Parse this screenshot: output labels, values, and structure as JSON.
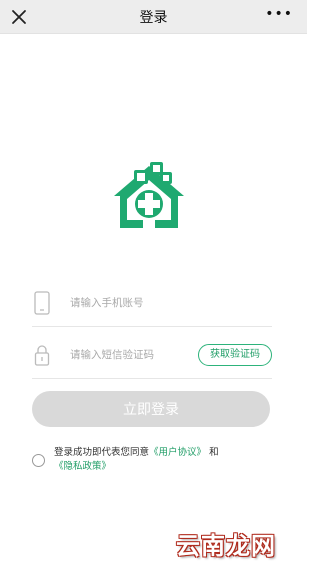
{
  "header": {
    "title": "登录",
    "close_icon": "close-icon",
    "more_label": "•••"
  },
  "logo": {
    "icon": "hospital-house-icon",
    "color": "#1fa970"
  },
  "phone": {
    "placeholder": "请输入手机账号",
    "icon": "phone-icon"
  },
  "code": {
    "placeholder": "请输入短信验证码",
    "icon": "lock-icon",
    "get_code_label": "获取验证码"
  },
  "login_button": {
    "label": "立即登录"
  },
  "agreement": {
    "prefix": "登录成功即代表您同意",
    "user_agreement": "《用户协议》",
    "and": "和",
    "privacy_policy": "《隐私政策》"
  },
  "watermark": {
    "text": "云南龙网"
  },
  "colors": {
    "accent": "#1fa970",
    "button_disabled": "#d9d9d9",
    "header_bg": "#ededed"
  }
}
